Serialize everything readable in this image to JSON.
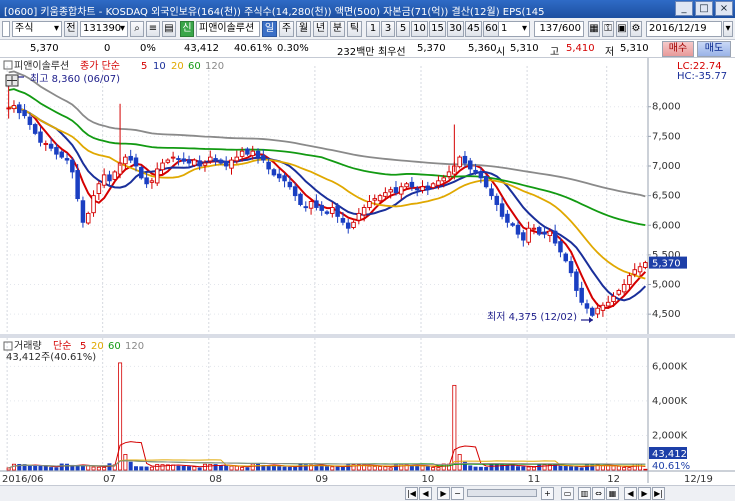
{
  "window": {
    "title": "[0600] 키움종합차트 - KOSDAQ 외국인보유(164(천)) 주식수(14,280(천)) 액면(500) 자본금(71(억)) 결산(12월) EPS(145",
    "buttons": [
      "_",
      "□",
      "×"
    ]
  },
  "toolbar": {
    "market_select": "주식",
    "prev_label": "전",
    "code": "131390",
    "badge_label": "신",
    "stock_name": "피앤이솔루션",
    "period_buttons": [
      "일",
      "주",
      "월",
      "년",
      "분",
      "틱"
    ],
    "active_period": "일",
    "interval_buttons": [
      "1",
      "3",
      "5",
      "10",
      "15",
      "30",
      "45",
      "60"
    ],
    "interval_value": "1",
    "count": "137",
    "count_max": "/600",
    "date": "2016/12/19"
  },
  "quote": {
    "price": "5,370",
    "change": "0",
    "change_rate": "0%",
    "volume": "43,412",
    "volume_rate": "40.61%",
    "turnover": "0.30%",
    "amount": "232백만",
    "preferred_label": "최우선",
    "best_price": "5,370",
    "bid": "5,360",
    "open_label": "시",
    "open": "5,310",
    "high_label": "고",
    "high": "5,410",
    "low_label": "저",
    "low": "5,310",
    "buy_button": "매수",
    "sell_button": "매도"
  },
  "price_panel": {
    "legend_name": "피앤이솔루션",
    "legend_type": "종가 단순",
    "ma_periods": [
      "5",
      "10",
      "20",
      "60",
      "120"
    ],
    "ma_colors": [
      "#d40000",
      "#1a2f9a",
      "#e0a800",
      "#129a12",
      "#8a8a8a"
    ],
    "high_note": "최고 8,360 (06/07)",
    "low_note": "최저 4,375 (12/02)",
    "lc_label": "LC:22.74",
    "hc_label": "HC:-35.77",
    "current_price_label": "5,370",
    "y_ticks": [
      "8,000",
      "7,500",
      "7,000",
      "6,500",
      "6,000",
      "5,500",
      "5,000",
      "4,500"
    ]
  },
  "volume_panel": {
    "legend_name": "거래량",
    "legend_type": "단순",
    "ma_periods": [
      "5",
      "20",
      "60",
      "120"
    ],
    "ma_colors": [
      "#d40000",
      "#e0a800",
      "#129a12",
      "#8a8a8a"
    ],
    "current_label": "43,412주(40.61%)",
    "y_ticks": [
      "6,000K",
      "4,000K",
      "2,000K"
    ],
    "last_value_label": "43,412",
    "last_ratio_label": "40.61%"
  },
  "x_axis": {
    "labels": [
      "2016/06",
      "07",
      "08",
      "09",
      "10",
      "11",
      "12",
      "12/19"
    ]
  },
  "chart_data": {
    "type": "candlestick",
    "price_range": [
      4300,
      8350
    ],
    "volume_range": [
      0,
      6600
    ],
    "volume_unit": "K",
    "months": [
      "2016/06",
      "07",
      "08",
      "09",
      "10",
      "11",
      "12"
    ],
    "price_series_daily_close": [
      7980,
      8020,
      7900,
      7850,
      7700,
      7550,
      7400,
      7380,
      7300,
      7200,
      7150,
      7100,
      6900,
      6450,
      6050,
      6200,
      6500,
      6700,
      6850,
      6750,
      6900,
      7050,
      7150,
      7100,
      7000,
      6800,
      6700,
      6750,
      6950,
      7050,
      7100,
      7150,
      7120,
      7080,
      7050,
      7100,
      7000,
      7050,
      7150,
      7100,
      7050,
      7000,
      7100,
      7150,
      7250,
      7200,
      7250,
      7150,
      7100,
      6950,
      6850,
      6800,
      6750,
      6650,
      6500,
      6350,
      6300,
      6400,
      6300,
      6250,
      6200,
      6300,
      6150,
      6050,
      5950,
      6050,
      6200,
      6300,
      6400,
      6450,
      6500,
      6550,
      6600,
      6550,
      6650,
      6700,
      6650,
      6600,
      6650,
      6600,
      6700,
      6750,
      6800,
      6900,
      7000,
      7150,
      7050,
      6950,
      6900,
      6800,
      6650,
      6500,
      6350,
      6150,
      6050,
      6000,
      5850,
      5750,
      5950,
      5950,
      5850,
      5850,
      5900,
      5700,
      5550,
      5400,
      5200,
      4900,
      4700,
      4600,
      4480,
      4600,
      4650,
      4700,
      4800,
      4900,
      5000,
      5150,
      5250,
      5300,
      5370
    ],
    "series": [
      {
        "name": "5",
        "type": "moving_average"
      },
      {
        "name": "10",
        "type": "moving_average"
      },
      {
        "name": "20",
        "type": "moving_average"
      },
      {
        "name": "60",
        "type": "moving_average"
      },
      {
        "name": "120",
        "type": "moving_average"
      }
    ],
    "volume_spikes_K": [
      {
        "month": "07",
        "value": 6200
      },
      {
        "month": "10",
        "value": 4900
      }
    ],
    "extremes": {
      "high": {
        "value": 8360,
        "date": "06/07"
      },
      "low": {
        "value": 4375,
        "date": "12/02"
      }
    },
    "last": {
      "price": 5370,
      "volume": 43412
    }
  }
}
